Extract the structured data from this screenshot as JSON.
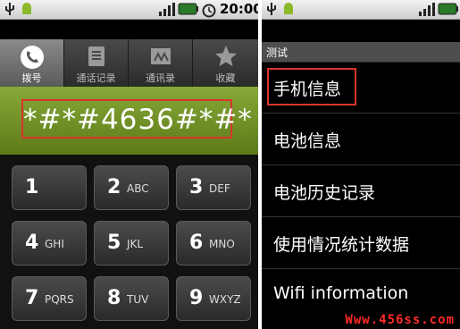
{
  "left": {
    "status": {
      "time": "20:00"
    },
    "tabs": [
      {
        "label": "拨号",
        "icon": "phone-icon"
      },
      {
        "label": "通话记录",
        "icon": "call-log-icon"
      },
      {
        "label": "通讯录",
        "icon": "contacts-icon"
      },
      {
        "label": "收藏",
        "icon": "star-icon"
      }
    ],
    "dial": {
      "value": "*#*#4636#*#*"
    },
    "keys": [
      {
        "num": "1",
        "letters": ""
      },
      {
        "num": "2",
        "letters": "ABC"
      },
      {
        "num": "3",
        "letters": "DEF"
      },
      {
        "num": "4",
        "letters": "GHI"
      },
      {
        "num": "5",
        "letters": "JKL"
      },
      {
        "num": "6",
        "letters": "MNO"
      },
      {
        "num": "7",
        "letters": "PQRS"
      },
      {
        "num": "8",
        "letters": "TUV"
      },
      {
        "num": "9",
        "letters": "WXYZ"
      }
    ]
  },
  "right": {
    "title": "测试",
    "menu": [
      {
        "label": "手机信息"
      },
      {
        "label": "电池信息"
      },
      {
        "label": "电池历史记录"
      },
      {
        "label": "使用情况统计数据"
      },
      {
        "label": "Wifi information"
      }
    ]
  },
  "watermark": "Www.456ss.com",
  "colors": {
    "accent_green": "#7a9a2a",
    "highlight_red": "#d8342c",
    "background": "#000000"
  }
}
